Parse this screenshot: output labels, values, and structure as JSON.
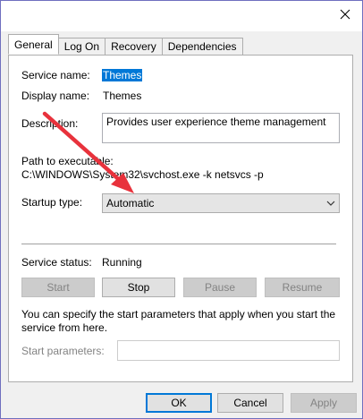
{
  "tabs": [
    {
      "label": "General",
      "active": true
    },
    {
      "label": "Log On",
      "active": false
    },
    {
      "label": "Recovery",
      "active": false
    },
    {
      "label": "Dependencies",
      "active": false
    }
  ],
  "general": {
    "service_name_label": "Service name:",
    "service_name_value": "Themes",
    "display_name_label": "Display name:",
    "display_name_value": "Themes",
    "description_label": "Description:",
    "description_value": "Provides user experience theme management.",
    "path_label": "Path to executable:",
    "path_value": "C:\\WINDOWS\\System32\\svchost.exe -k netsvcs -p",
    "startup_type_label": "Startup type:",
    "startup_type_value": "Automatic",
    "service_status_label": "Service status:",
    "service_status_value": "Running",
    "start_label": "Start",
    "stop_label": "Stop",
    "pause_label": "Pause",
    "resume_label": "Resume",
    "info_text": "You can specify the start parameters that apply when you start the service from here.",
    "start_params_label": "Start parameters:",
    "start_params_value": ""
  },
  "footer": {
    "ok_label": "OK",
    "cancel_label": "Cancel",
    "apply_label": "Apply"
  },
  "colors": {
    "selection": "#0078d7",
    "annotation_arrow": "#e8323c",
    "window_border": "#6f6fbf"
  }
}
